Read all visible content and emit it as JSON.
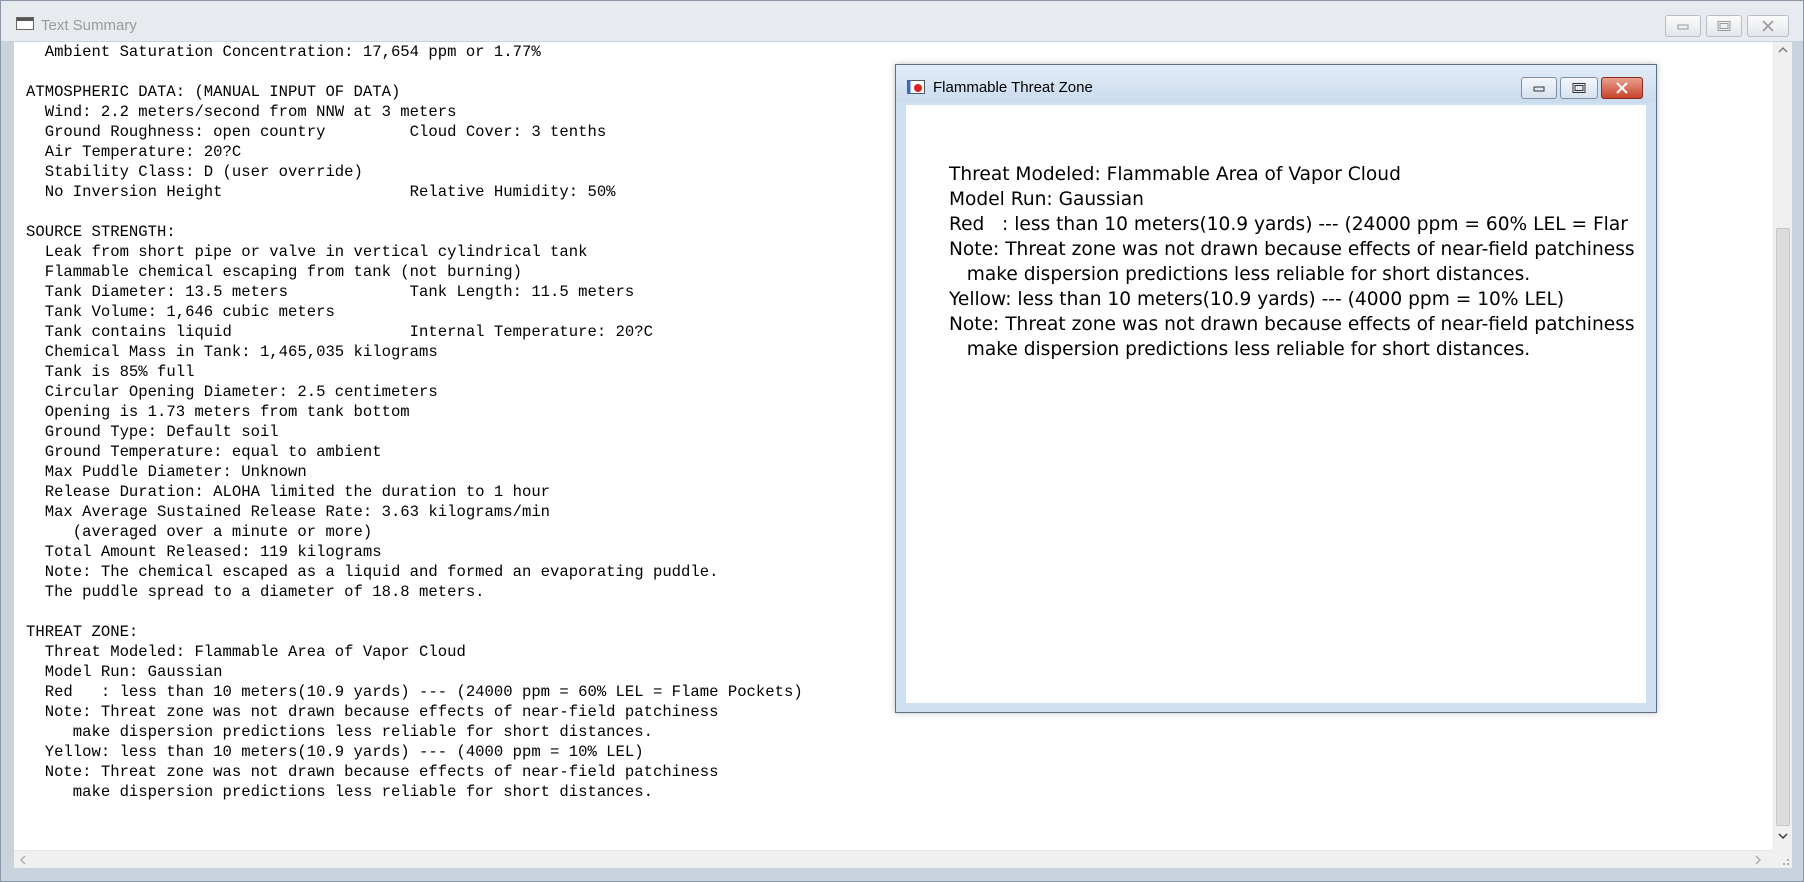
{
  "outer_window": {
    "title": "Text Summary",
    "controls": {
      "minimize_icon": "minimize-icon",
      "maximize_icon": "maximize-icon",
      "close_icon": "close-icon"
    }
  },
  "summary": {
    "lines": [
      "  Ambient Saturation Concentration: 17,654 ppm or 1.77%",
      "",
      "ATMOSPHERIC DATA: (MANUAL INPUT OF DATA)",
      "  Wind: 2.2 meters/second from NNW at 3 meters",
      "  Ground Roughness: open country         Cloud Cover: 3 tenths",
      "  Air Temperature: 20?C",
      "  Stability Class: D (user override)",
      "  No Inversion Height                    Relative Humidity: 50%",
      "",
      "SOURCE STRENGTH:",
      "  Leak from short pipe or valve in vertical cylindrical tank",
      "  Flammable chemical escaping from tank (not burning)",
      "  Tank Diameter: 13.5 meters             Tank Length: 11.5 meters",
      "  Tank Volume: 1,646 cubic meters",
      "  Tank contains liquid                   Internal Temperature: 20?C",
      "  Chemical Mass in Tank: 1,465,035 kilograms",
      "  Tank is 85% full",
      "  Circular Opening Diameter: 2.5 centimeters",
      "  Opening is 1.73 meters from tank bottom",
      "  Ground Type: Default soil",
      "  Ground Temperature: equal to ambient",
      "  Max Puddle Diameter: Unknown",
      "  Release Duration: ALOHA limited the duration to 1 hour",
      "  Max Average Sustained Release Rate: 3.63 kilograms/min",
      "     (averaged over a minute or more)",
      "  Total Amount Released: 119 kilograms",
      "  Note: The chemical escaped as a liquid and formed an evaporating puddle.",
      "  The puddle spread to a diameter of 18.8 meters.",
      "",
      "THREAT ZONE:",
      "  Threat Modeled: Flammable Area of Vapor Cloud",
      "  Model Run: Gaussian",
      "  Red   : less than 10 meters(10.9 yards) --- (24000 ppm = 60% LEL = Flame Pockets)",
      "  Note: Threat zone was not drawn because effects of near-field patchiness",
      "     make dispersion predictions less reliable for short distances.",
      "  Yellow: less than 10 meters(10.9 yards) --- (4000 ppm = 10% LEL)",
      "  Note: Threat zone was not drawn because effects of near-field patchiness",
      "     make dispersion predictions less reliable for short distances."
    ]
  },
  "threat_window": {
    "title": "Flammable Threat Zone",
    "lines": [
      "Threat Modeled: Flammable Area of Vapor Cloud",
      "Model Run: Gaussian",
      "Red   : less than 10 meters(10.9 yards) --- (24000 ppm = 60% LEL = Flar",
      "Note: Threat zone was not drawn because effects of near-field patchiness",
      "   make dispersion predictions less reliable for short distances.",
      "Yellow: less than 10 meters(10.9 yards) --- (4000 ppm = 10% LEL)",
      "Note: Threat zone was not drawn because effects of near-field patchiness",
      "   make dispersion predictions less reliable for short distances."
    ],
    "colors": {
      "icon_red": "#e02020",
      "close_button": "#c6442c"
    }
  }
}
